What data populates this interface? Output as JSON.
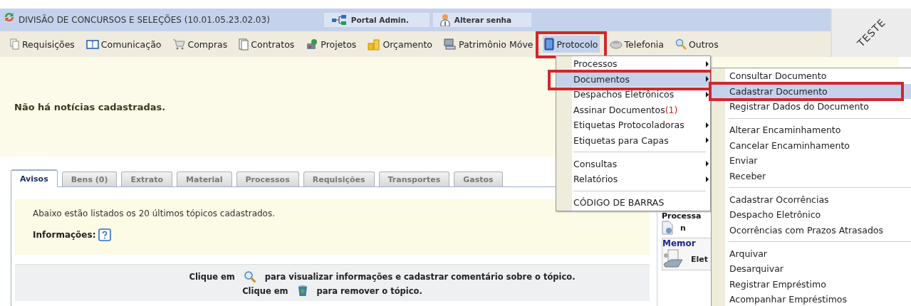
{
  "header": {
    "unit": "DIVISÃO DE CONCURSOS E SELEÇÕES (10.01.05.23.02.03)",
    "links": [
      {
        "label": "Portal Admin."
      },
      {
        "label": "Alterar senha"
      }
    ],
    "environment": "TESTE"
  },
  "menubar": [
    {
      "label": "Requisições",
      "selected": false
    },
    {
      "label": "Comunicação",
      "selected": false
    },
    {
      "label": "Compras",
      "selected": false
    },
    {
      "label": "Contratos",
      "selected": false
    },
    {
      "label": "Projetos",
      "selected": false
    },
    {
      "label": "Orçamento",
      "selected": false
    },
    {
      "label": "Patrimônio Móve",
      "selected": false
    },
    {
      "label": "Protocolo",
      "selected": true
    },
    {
      "label": "Telefonia",
      "selected": false
    },
    {
      "label": "Outros",
      "selected": false
    }
  ],
  "news": {
    "message": "Não há notícias cadastradas."
  },
  "tabs": [
    {
      "label": "Avisos",
      "selected": true
    },
    {
      "label": "Bens (0)",
      "selected": false
    },
    {
      "label": "Extrato",
      "selected": false
    },
    {
      "label": "Material",
      "selected": false
    },
    {
      "label": "Processos",
      "selected": false
    },
    {
      "label": "Requisições",
      "selected": false
    },
    {
      "label": "Transportes",
      "selected": false
    },
    {
      "label": "Gastos",
      "selected": false
    }
  ],
  "notice": {
    "text": "Abaixo estão listados os 20 últimos tópicos cadastrados.",
    "info_label": "Informações:"
  },
  "hints": [
    {
      "prefix": "Clique em",
      "text": "para visualizar informações e cadastrar comentário sobre o tópico."
    },
    {
      "prefix": "Clique em",
      "text": "para remover o tópico."
    }
  ],
  "sidebar": [
    {
      "title": "Processa",
      "caption": "n"
    },
    {
      "title": "Memor",
      "caption": "Elet"
    }
  ],
  "dropdown": [
    {
      "kind": "item",
      "label": "Processos",
      "submenu": true,
      "selected": false
    },
    {
      "kind": "item",
      "label": "Documentos",
      "submenu": true,
      "selected": true
    },
    {
      "kind": "item",
      "label": "Despachos Eletrônicos",
      "submenu": true,
      "selected": false
    },
    {
      "kind": "item",
      "label": "Assinar Documentos",
      "badge": "(1)",
      "submenu": false,
      "selected": false
    },
    {
      "kind": "item",
      "label": "Etiquetas Protocoladoras",
      "submenu": true,
      "selected": false
    },
    {
      "kind": "item",
      "label": "Etiquetas para Capas",
      "submenu": true,
      "selected": false
    },
    {
      "kind": "separator"
    },
    {
      "kind": "item",
      "label": "Consultas",
      "submenu": true,
      "selected": false
    },
    {
      "kind": "item",
      "label": "Relatórios",
      "submenu": true,
      "selected": false
    },
    {
      "kind": "separator"
    },
    {
      "kind": "item",
      "label": "CÓDIGO DE BARRAS",
      "submenu": false,
      "selected": false
    }
  ],
  "submenu": [
    {
      "kind": "item",
      "label": "Consultar Documento",
      "selected": false
    },
    {
      "kind": "item",
      "label": "Cadastrar Documento",
      "selected": true
    },
    {
      "kind": "item",
      "label": "Registrar Dados do Documento",
      "selected": false
    },
    {
      "kind": "separator"
    },
    {
      "kind": "item",
      "label": "Alterar Encaminhamento",
      "selected": false
    },
    {
      "kind": "item",
      "label": "Cancelar Encaminhamento",
      "selected": false
    },
    {
      "kind": "item",
      "label": "Enviar",
      "selected": false
    },
    {
      "kind": "item",
      "label": "Receber",
      "selected": false
    },
    {
      "kind": "separator"
    },
    {
      "kind": "item",
      "label": "Cadastrar Ocorrências",
      "selected": false
    },
    {
      "kind": "item",
      "label": "Despacho Eletrônico",
      "selected": false
    },
    {
      "kind": "item",
      "label": "Ocorrências com Prazos Atrasados",
      "selected": false
    },
    {
      "kind": "separator"
    },
    {
      "kind": "item",
      "label": "Arquivar",
      "selected": false
    },
    {
      "kind": "item",
      "label": "Desarquivar",
      "selected": false
    },
    {
      "kind": "item",
      "label": "Registrar Empréstimo",
      "selected": false
    },
    {
      "kind": "item",
      "label": "Acompanhar Empréstimos",
      "selected": false
    }
  ]
}
